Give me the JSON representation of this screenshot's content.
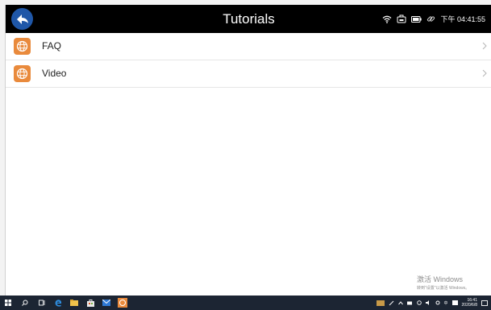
{
  "app": {
    "title": "Tutorials",
    "back_icon": "back-arrow-icon",
    "status": {
      "icons": [
        "wifi-icon",
        "device-icon",
        "battery-icon",
        "link-icon"
      ],
      "time": "下午 04:41:55"
    }
  },
  "list": {
    "items": [
      {
        "label": "FAQ",
        "icon": "globe-icon"
      },
      {
        "label": "Video",
        "icon": "globe-icon"
      }
    ]
  },
  "watermark": {
    "line1": "激活 Windows",
    "line2": "转到\"设置\"以激活 Windows。"
  },
  "taskbar": {
    "clock_time": "16:41",
    "clock_date": "2020/6/8",
    "ime": "中"
  },
  "colors": {
    "titlebar": "#000000",
    "back_button": "#1f57a8",
    "item_icon": "#e98a3c",
    "taskbar": "#1c2533"
  }
}
